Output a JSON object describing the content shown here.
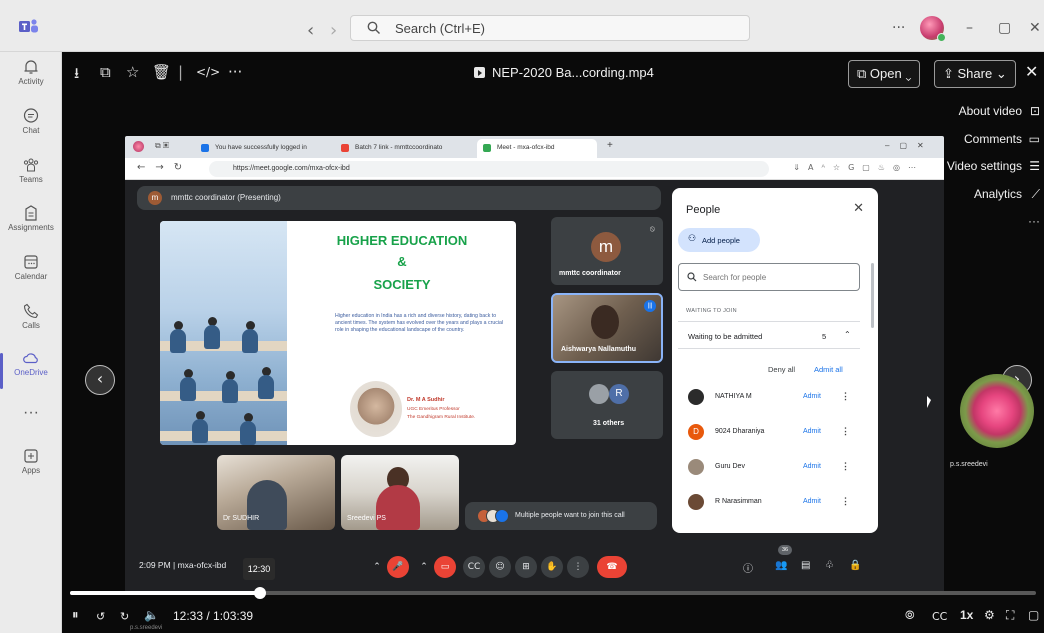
{
  "teams": {
    "search_placeholder": "Search (Ctrl+E)",
    "more": "···",
    "rail": [
      {
        "label": "Activity",
        "icon": "bell-icon"
      },
      {
        "label": "Chat",
        "icon": "chat-icon"
      },
      {
        "label": "Teams",
        "icon": "teams-icon"
      },
      {
        "label": "Assignments",
        "icon": "assignments-icon"
      },
      {
        "label": "Calendar",
        "icon": "calendar-icon"
      },
      {
        "label": "Calls",
        "icon": "phone-icon"
      },
      {
        "label": "OneDrive",
        "icon": "cloud-icon"
      },
      {
        "label": "Apps",
        "icon": "plus-box-icon"
      }
    ],
    "accent": "#5b5fc7"
  },
  "viewer": {
    "file_title": "NEP-2020 Ba...cording.mp4",
    "open_label": "Open",
    "share_label": "Share",
    "side_menu": [
      "About video",
      "Comments",
      "Video settings",
      "Analytics"
    ],
    "current_time": "12:33 / 1:03:39",
    "hover_time": "12:30",
    "progress": 0.197,
    "speed": "1x",
    "background_tile_name": "p.s.sreedevi"
  },
  "browser": {
    "tabs": [
      "You have successfully logged in",
      "Batch 7 link - mmttccoordinato",
      "Meet - mxa-ofcx-ibd"
    ],
    "url": "https://meet.google.com/mxa-ofcx-ibd"
  },
  "meet": {
    "presenter_bar": "mmttc coordinator (Presenting)",
    "presenter_initial": "m",
    "slide": {
      "heading_1": "HIGHER EDUCATION",
      "heading_2": "&",
      "heading_3": "SOCIETY",
      "paragraph": "Higher education in India has a rich and diverse history, dating back to ancient times. The system has evolved over the years and plays a crucial role in shaping the educational landscape of the country.",
      "speaker_name": "Dr. M A Sudhir",
      "speaker_role_1": "UGC Emeritus Professor",
      "speaker_role_2": "The Gandhigram Rural Institute."
    },
    "tiles": {
      "coordinator_name": "mmttc coordinator",
      "coordinator_initial": "m",
      "active_speaker_name": "Aishwarya Nallamuthu",
      "others_initial": "R",
      "others_label": "31 others",
      "cam_1_name": "Dr SUDHIR",
      "cam_2_name": "Sreedevi PS"
    },
    "join_banner": "Multiple people want to join this call",
    "meeting_time": "2:09 PM | mxa-ofcx-ibd",
    "participant_count": "36",
    "people_panel": {
      "title": "People",
      "add_people": "Add people",
      "search_placeholder": "Search for people",
      "section_label": "WAITING TO JOIN",
      "waiting_label": "Waiting to be admitted",
      "waiting_count": "5",
      "deny_all": "Deny all",
      "admit_all": "Admit all",
      "admit_label": "Admit",
      "waiting_people": [
        {
          "name": "NATHIYA M",
          "initial": "",
          "color": "#2b2b2b"
        },
        {
          "name": "9024 Dharaniya",
          "initial": "D",
          "color": "#e8590c"
        },
        {
          "name": "Guru Dev",
          "initial": "",
          "color": "#9a8a7a"
        },
        {
          "name": "R Narasimman",
          "initial": "",
          "color": "#6b4a35"
        }
      ]
    }
  }
}
